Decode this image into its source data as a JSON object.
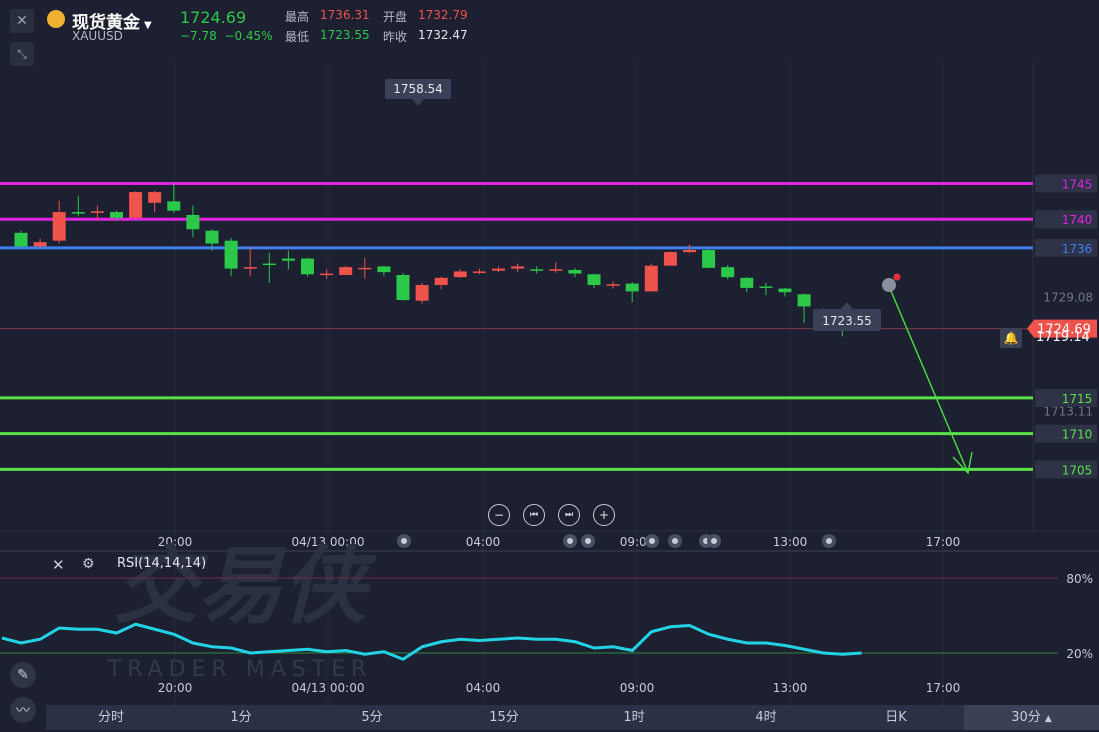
{
  "header": {
    "name": "现货黄金",
    "symbol": "XAUUSD",
    "price": "1724.69",
    "change": "−7.78",
    "change_pct": "−0.45%",
    "high_label": "最高",
    "high": "1736.31",
    "open_label": "开盘",
    "open": "1732.79",
    "low_label": "最低",
    "low": "1723.55",
    "prev_label": "昨收",
    "prev": "1732.47"
  },
  "colors": {
    "up": "#f0524c",
    "down": "#2cc84a",
    "background": "#1c2030",
    "magenta": "#e024e0",
    "blue": "#3f7ff0",
    "green": "#5ae048",
    "rsi": "#22d3e6"
  },
  "watermark": {
    "cn": "交易侠",
    "en": "TRADER MASTER"
  },
  "chart_data": [
    {
      "type": "candlestick",
      "ylim": [
        1701,
        1762
      ],
      "x_labels": [
        "20:00",
        "04/13 00:00",
        "04:00",
        "09:00",
        "13:00",
        "17:00"
      ],
      "horizontal_lines": [
        {
          "value": 1745,
          "label": "1745",
          "color": "#e024e0"
        },
        {
          "value": 1740,
          "label": "1740",
          "color": "#e024e0"
        },
        {
          "value": 1736,
          "label": "1736",
          "color": "#3f7ff0"
        },
        {
          "value": 1715,
          "label": "1715",
          "color": "#5ae048"
        },
        {
          "value": 1710,
          "label": "1710",
          "color": "#5ae048"
        },
        {
          "value": 1705,
          "label": "1705",
          "color": "#5ae048"
        }
      ],
      "y_axis_labels": [
        "1729.08",
        "1713.11"
      ],
      "current_price_label": "1724.69",
      "alert_price_label": "1719.14",
      "high_marker": "1758.54",
      "low_marker": "1723.55",
      "candles": [
        {
          "o": 1738.1,
          "c": 1736.2,
          "h": 1738.4,
          "l": 1736.0
        },
        {
          "o": 1736.2,
          "c": 1736.8,
          "h": 1737.3,
          "l": 1736.0
        },
        {
          "o": 1737.0,
          "c": 1741.0,
          "h": 1742.6,
          "l": 1736.6
        },
        {
          "o": 1741.0,
          "c": 1740.9,
          "h": 1743.3,
          "l": 1740.4
        },
        {
          "o": 1741.0,
          "c": 1741.1,
          "h": 1741.9,
          "l": 1739.9
        },
        {
          "o": 1741.0,
          "c": 1740.2,
          "h": 1741.2,
          "l": 1739.8
        },
        {
          "o": 1740.2,
          "c": 1743.8,
          "h": 1743.9,
          "l": 1740.0
        },
        {
          "o": 1742.3,
          "c": 1743.8,
          "h": 1744.0,
          "l": 1741.0
        },
        {
          "o": 1742.5,
          "c": 1741.2,
          "h": 1745.0,
          "l": 1740.9
        },
        {
          "o": 1740.6,
          "c": 1738.6,
          "h": 1741.9,
          "l": 1737.5
        },
        {
          "o": 1738.4,
          "c": 1736.6,
          "h": 1738.6,
          "l": 1735.6
        },
        {
          "o": 1737.0,
          "c": 1733.1,
          "h": 1737.4,
          "l": 1732.0
        },
        {
          "o": 1733.3,
          "c": 1733.3,
          "h": 1736.2,
          "l": 1732.0
        },
        {
          "o": 1733.8,
          "c": 1733.7,
          "h": 1735.3,
          "l": 1731.1
        },
        {
          "o": 1734.5,
          "c": 1734.2,
          "h": 1735.6,
          "l": 1733.0
        },
        {
          "o": 1734.5,
          "c": 1732.3,
          "h": 1734.6,
          "l": 1732.0
        },
        {
          "o": 1732.4,
          "c": 1732.4,
          "h": 1733.0,
          "l": 1731.7
        },
        {
          "o": 1732.2,
          "c": 1733.3,
          "h": 1733.5,
          "l": 1732.2
        },
        {
          "o": 1733.2,
          "c": 1733.2,
          "h": 1734.6,
          "l": 1731.7
        },
        {
          "o": 1733.4,
          "c": 1732.6,
          "h": 1733.5,
          "l": 1732.1
        },
        {
          "o": 1732.2,
          "c": 1728.7,
          "h": 1732.5,
          "l": 1728.6
        },
        {
          "o": 1728.6,
          "c": 1730.8,
          "h": 1731.1,
          "l": 1728.2
        },
        {
          "o": 1730.8,
          "c": 1731.8,
          "h": 1732.0,
          "l": 1730.2
        },
        {
          "o": 1731.9,
          "c": 1732.7,
          "h": 1733.0,
          "l": 1731.8
        },
        {
          "o": 1732.6,
          "c": 1732.7,
          "h": 1733.1,
          "l": 1732.3
        },
        {
          "o": 1732.8,
          "c": 1733.1,
          "h": 1733.4,
          "l": 1732.6
        },
        {
          "o": 1733.1,
          "c": 1733.4,
          "h": 1733.8,
          "l": 1732.6
        },
        {
          "o": 1733.0,
          "c": 1732.8,
          "h": 1733.4,
          "l": 1732.4
        },
        {
          "o": 1732.9,
          "c": 1733.0,
          "h": 1734.0,
          "l": 1732.5
        },
        {
          "o": 1732.9,
          "c": 1732.4,
          "h": 1733.2,
          "l": 1731.9
        },
        {
          "o": 1732.3,
          "c": 1730.8,
          "h": 1732.4,
          "l": 1730.4
        },
        {
          "o": 1730.9,
          "c": 1730.9,
          "h": 1731.3,
          "l": 1730.3
        },
        {
          "o": 1731.0,
          "c": 1729.9,
          "h": 1731.2,
          "l": 1728.4
        },
        {
          "o": 1729.9,
          "c": 1733.5,
          "h": 1733.8,
          "l": 1729.9
        },
        {
          "o": 1733.5,
          "c": 1735.4,
          "h": 1735.5,
          "l": 1733.5
        },
        {
          "o": 1735.4,
          "c": 1735.7,
          "h": 1736.5,
          "l": 1735.3
        },
        {
          "o": 1735.7,
          "c": 1733.2,
          "h": 1735.8,
          "l": 1733.2
        },
        {
          "o": 1733.3,
          "c": 1731.9,
          "h": 1733.6,
          "l": 1731.6
        },
        {
          "o": 1731.8,
          "c": 1730.4,
          "h": 1731.9,
          "l": 1729.8
        },
        {
          "o": 1730.6,
          "c": 1730.4,
          "h": 1731.1,
          "l": 1729.4
        },
        {
          "o": 1730.3,
          "c": 1729.8,
          "h": 1730.4,
          "l": 1729.2
        },
        {
          "o": 1729.5,
          "c": 1727.8,
          "h": 1729.6,
          "l": 1725.5
        },
        {
          "o": 1727.4,
          "c": 1725.8,
          "h": 1727.5,
          "l": 1725.7
        },
        {
          "o": 1725.4,
          "c": 1724.7,
          "h": 1726.2,
          "l": 1723.6
        },
        {
          "o": 1724.6,
          "c": 1724.8,
          "h": 1725.6,
          "l": 1724.4
        }
      ]
    },
    {
      "type": "line",
      "name": "RSI(14,14,14)",
      "levels": [
        "80%",
        "20%"
      ],
      "ylim": [
        0,
        100
      ],
      "x_labels": [
        "20:00",
        "04/13 00:00",
        "04:00",
        "09:00",
        "13:00",
        "17:00"
      ],
      "values": [
        32,
        28,
        31,
        40,
        39,
        39,
        36,
        43,
        39,
        35,
        28,
        25,
        24,
        20,
        21,
        22,
        23,
        21,
        22,
        19,
        21,
        15,
        25,
        29,
        31,
        30,
        31,
        32,
        31,
        31,
        29,
        24,
        25,
        22,
        37,
        41,
        42,
        35,
        31,
        28,
        28,
        26,
        23,
        20,
        19,
        20
      ]
    }
  ],
  "zoom_controls": [
    "−",
    "⏮",
    "⏭",
    "+"
  ],
  "timeframes": [
    "分时",
    "1分",
    "5分",
    "15分",
    "1时",
    "4时",
    "日K",
    "30分"
  ],
  "timeframe_active": "30分"
}
